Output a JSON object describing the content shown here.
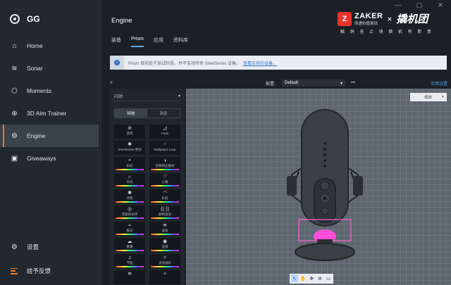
{
  "window": {
    "minimize": "—",
    "maximize": "▢",
    "close": "✕"
  },
  "sidebar": {
    "brand": "GG",
    "items": [
      {
        "label": "Home",
        "icon": "home-icon",
        "glyph": "⌂"
      },
      {
        "label": "Sonar",
        "icon": "sonar-icon",
        "glyph": "≋"
      },
      {
        "label": "Moments",
        "icon": "moments-icon",
        "glyph": "⬡"
      },
      {
        "label": "3D Aim Trainer",
        "icon": "crosshair-icon",
        "glyph": "⊕"
      },
      {
        "label": "Engine",
        "icon": "engine-icon",
        "glyph": "⚙"
      },
      {
        "label": "Giveaways",
        "icon": "gift-icon",
        "glyph": "▣"
      }
    ],
    "active": "Engine",
    "settings_label": "设置",
    "feedback_label": "给予反馈"
  },
  "header": {
    "title": "Engine"
  },
  "watermark": {
    "z": "Z",
    "zaker": "ZAKER",
    "zaker_sub": "传递价值资讯",
    "x": "×",
    "tuan": "撬机团",
    "slogan": "触 洞 无 止 境   换 机 有 新 意"
  },
  "tabs": [
    {
      "label": "装备"
    },
    {
      "label": "Prism",
      "active": true
    },
    {
      "label": "应用"
    },
    {
      "label": "资料库"
    }
  ],
  "notice": {
    "text": "Prism 目前处于测试阶段，并不支持所有 SteelSeries 设备。",
    "link": "查看支持的设备。"
  },
  "config": {
    "label": "配置:",
    "value": "Default",
    "more": "•••",
    "link": "实用设置"
  },
  "effects": {
    "mode": "闪动",
    "segments": [
      "特效",
      "渐变"
    ],
    "tiles": [
      {
        "label": "禁用",
        "glyph": "⊘",
        "bar": false
      },
      {
        "label": "Fade",
        "glyph": "◿",
        "bar": false
      },
      {
        "label": "SteelSeries 原创",
        "glyph": "✺",
        "bar": false
      },
      {
        "label": "Wallpaper Loop",
        "glyph": "⁘",
        "bar": false
      },
      {
        "label": "彩虹",
        "glyph": "◓",
        "bar": true
      },
      {
        "label": "音频响应模式",
        "glyph": "◑",
        "bar": true
      },
      {
        "label": "日光",
        "glyph": "☼",
        "bar": true
      },
      {
        "label": "心跳",
        "glyph": "♡",
        "bar": true
      },
      {
        "label": "环绕",
        "glyph": "✺",
        "bar": true
      },
      {
        "label": "彩虹",
        "glyph": "◠",
        "bar": true
      },
      {
        "label": "音频的光环",
        "glyph": "◎",
        "bar": true
      },
      {
        "label": "颜色波动",
        "glyph": "((·))",
        "bar": true
      },
      {
        "label": "极光",
        "glyph": "≈",
        "bar": true
      },
      {
        "label": "波浪",
        "glyph": "≋",
        "bar": true
      },
      {
        "label": "雷暴",
        "glyph": "☁",
        "bar": true
      },
      {
        "label": "涟漪",
        "glyph": "◉",
        "bar": true
      },
      {
        "label": "节拍",
        "glyph": "♫",
        "bar": true
      },
      {
        "label": "流光溢彩",
        "glyph": "✧",
        "bar": true
      },
      {
        "label": "",
        "glyph": "≋",
        "bar": false
      },
      {
        "label": "",
        "glyph": "✧",
        "bar": false
      }
    ]
  },
  "canvas": {
    "zoom_value": "缩放",
    "zoom_caret": "▾",
    "tools": [
      "↖",
      "✋",
      "✥",
      "⊕",
      "▭"
    ],
    "accent_glow": "#ff4fd8",
    "selection_color": "#ff5fd0"
  }
}
